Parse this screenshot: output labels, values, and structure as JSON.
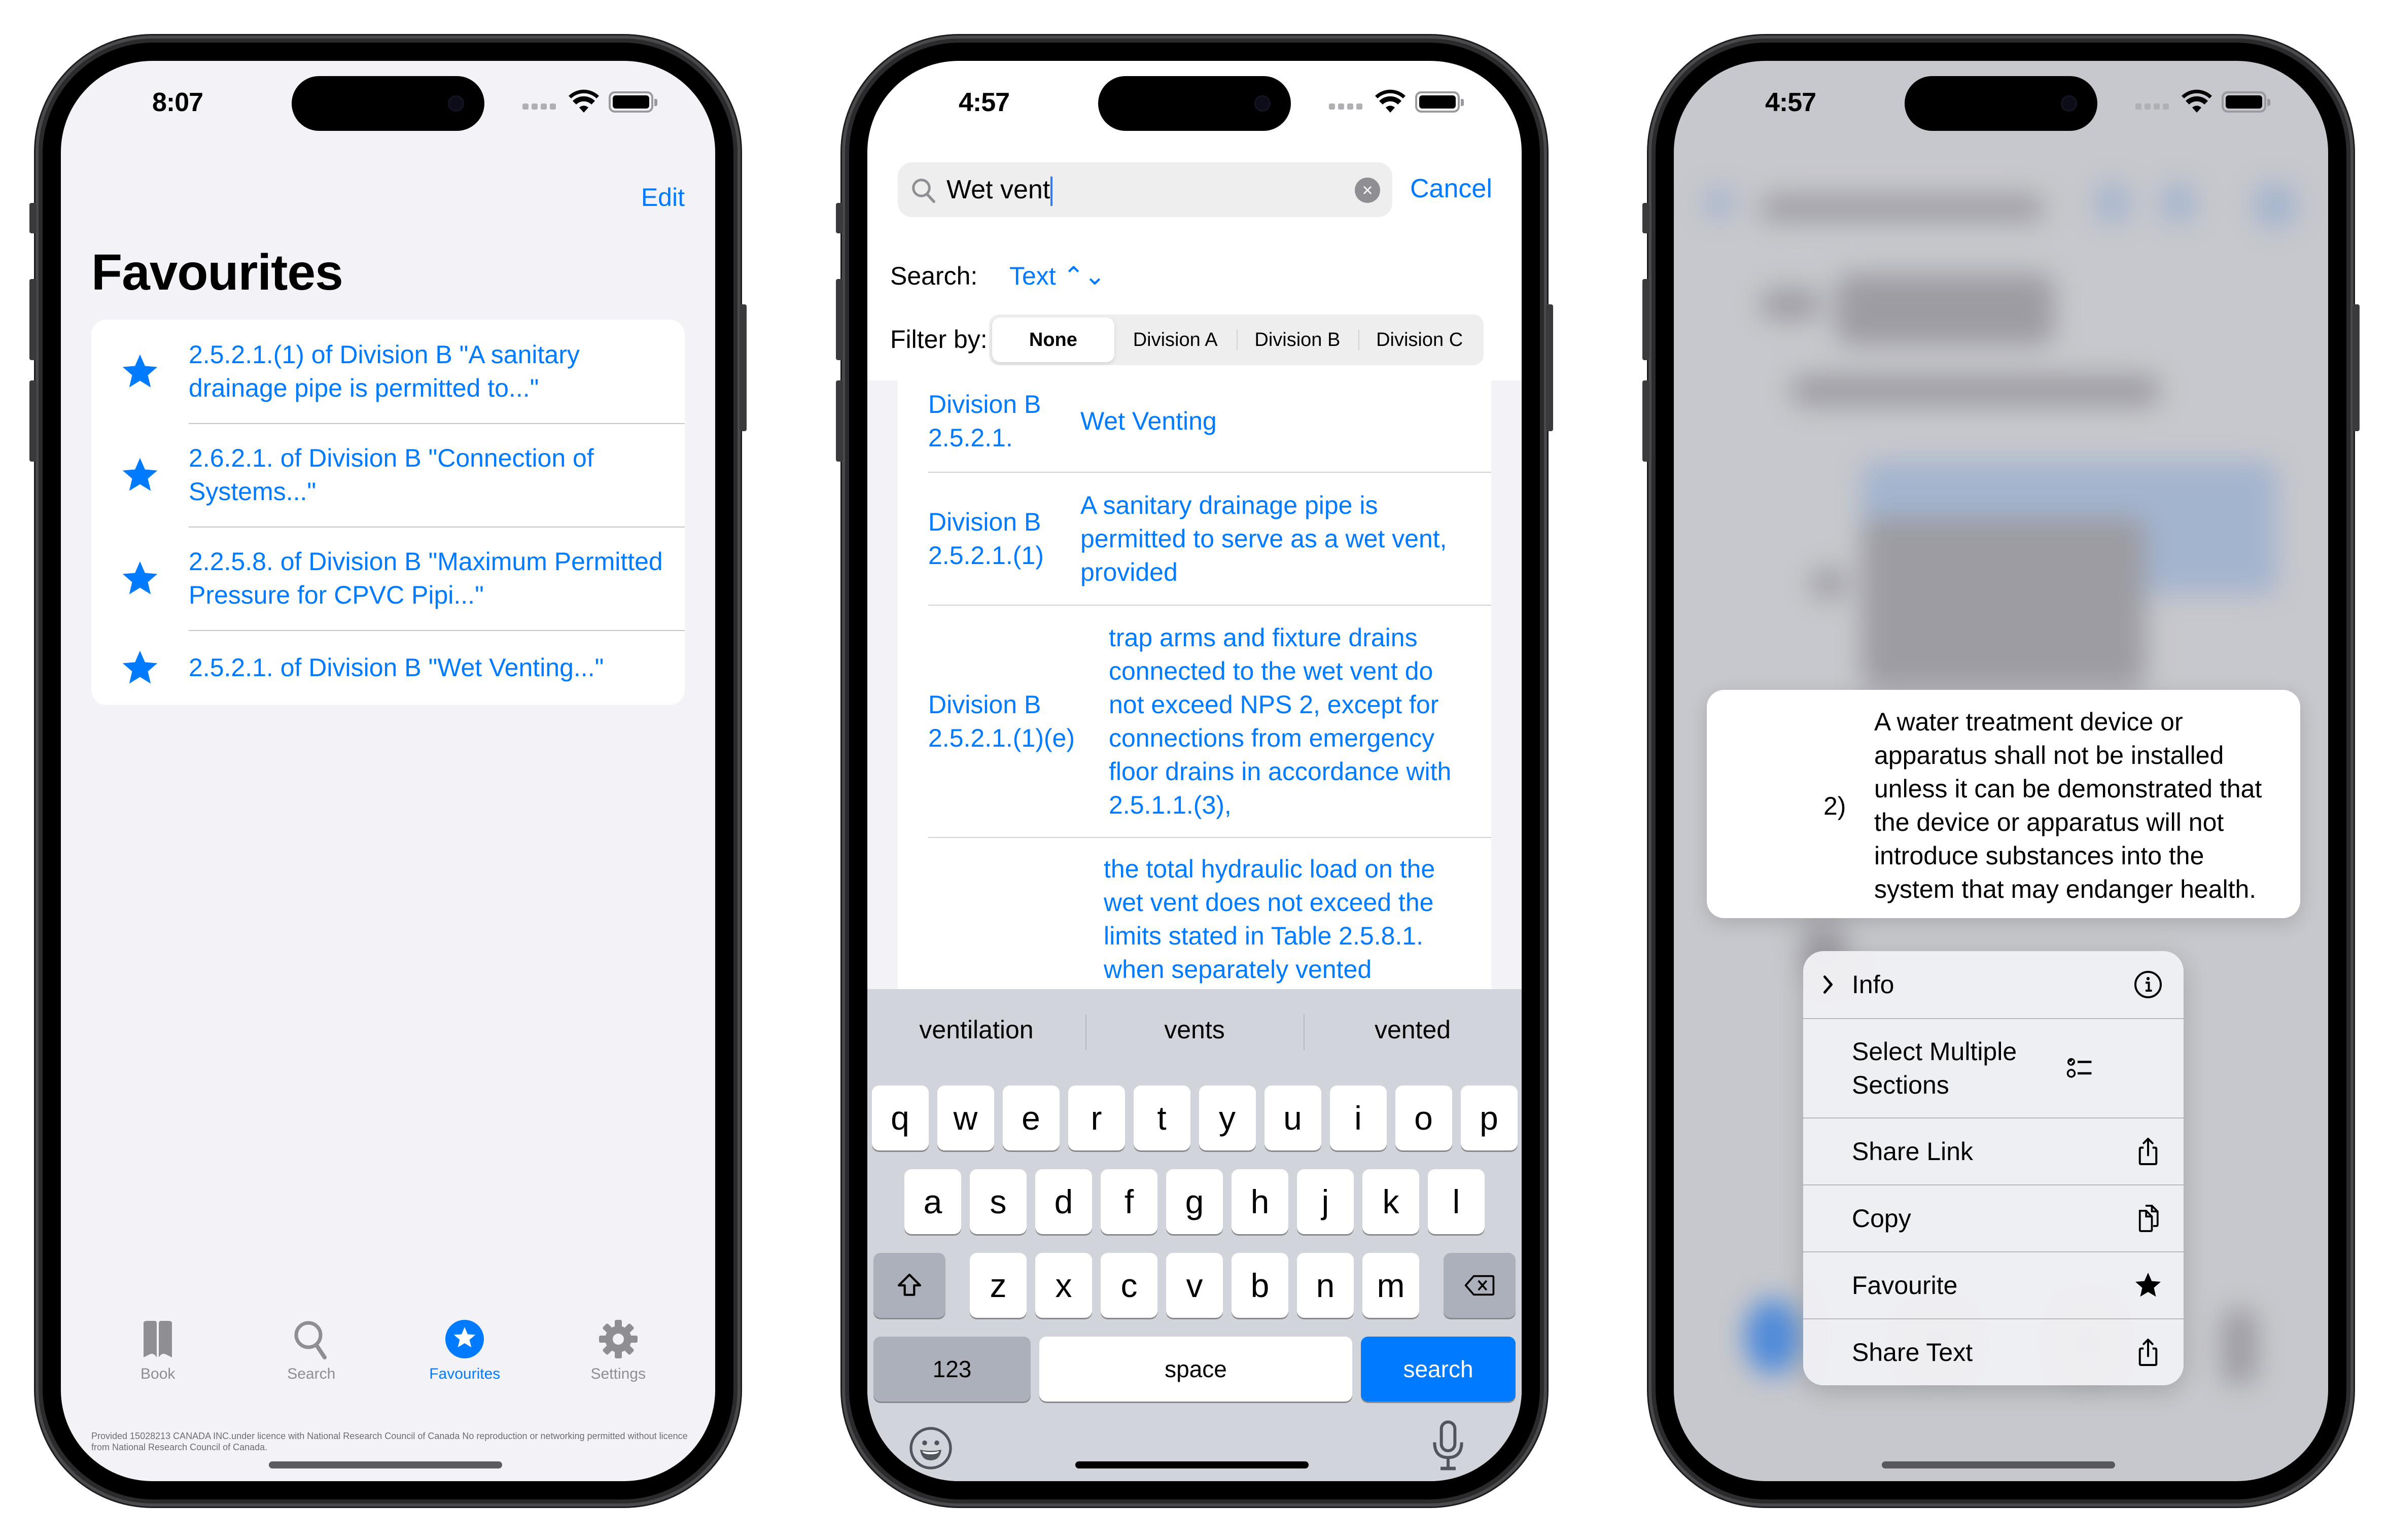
{
  "phones": [
    {
      "status": {
        "time": "8:07"
      },
      "nav": {
        "edit_label": "Edit",
        "title": "Favourites"
      },
      "favourites": [
        {
          "text": "2.5.2.1.(1) of Division B \"A sanitary drainage pipe is permitted to...\""
        },
        {
          "text": "2.6.2.1. of Division B \"Connection of Systems...\""
        },
        {
          "text": "2.2.5.8. of Division B \"Maximum Permitted Pressure for CPVC Pipi...\""
        },
        {
          "text": "2.5.2.1. of Division B \"Wet Venting...\""
        }
      ],
      "tabbar": {
        "tabs": [
          {
            "label": "Book",
            "icon": "book-icon",
            "active": false
          },
          {
            "label": "Search",
            "icon": "search-icon",
            "active": false
          },
          {
            "label": "Favourites",
            "icon": "star-circle-icon",
            "active": true
          },
          {
            "label": "Settings",
            "icon": "gear-icon",
            "active": false
          }
        ]
      },
      "licence": "Provided 15028213 CANADA INC.under licence with National Research Council of Canada No reproduction or networking permitted without licence from National Research Council of Canada."
    },
    {
      "status": {
        "time": "4:57"
      },
      "search": {
        "value": "Wet vent",
        "cancel_label": "Cancel",
        "search_label": "Search:",
        "search_type": "Text ⌃⌄",
        "filter_label": "Filter by:",
        "filters": [
          {
            "label": "None",
            "selected": true
          },
          {
            "label": "Division A",
            "selected": false
          },
          {
            "label": "Division B",
            "selected": false
          },
          {
            "label": "Division C",
            "selected": false
          }
        ]
      },
      "results": [
        {
          "ref": "Division B 2.5.2.1.",
          "text": "Wet Venting"
        },
        {
          "ref": "Division B 2.5.2.1.(1)",
          "text": "A sanitary drainage pipe is permitted to serve as a wet vent, provided"
        },
        {
          "ref": "Division B 2.5.2.1.(1)(e)",
          "text": "trap arms and fixture drains connected to the wet vent do not exceed NPS 2, except for connections from emergency floor drains in accordance with 2.5.1.1.(3),"
        },
        {
          "ref": "",
          "text": "the total hydraulic load on the wet vent does not exceed the limits stated in Table 2.5.8.1. when separately vented"
        }
      ],
      "keyboard": {
        "suggestions": [
          "ventilation",
          "vents",
          "vented"
        ],
        "row1": [
          "q",
          "w",
          "e",
          "r",
          "t",
          "y",
          "u",
          "i",
          "o",
          "p"
        ],
        "row2": [
          "a",
          "s",
          "d",
          "f",
          "g",
          "h",
          "j",
          "k",
          "l"
        ],
        "row3": [
          "z",
          "x",
          "c",
          "v",
          "b",
          "n",
          "m"
        ],
        "numbers_label": "123",
        "space_label": "space",
        "action_label": "search"
      }
    },
    {
      "status": {
        "time": "4:57"
      },
      "preview": {
        "number": "2)",
        "text": "A water treatment device or apparatus shall not be installed unless it can be demonstrated that the device or apparatus will not introduce substances into the system that may endanger health."
      },
      "menu": [
        {
          "label": "Info",
          "icon": "info-circle-icon",
          "has_chevron": true
        },
        {
          "label": "Select Multiple Sections",
          "icon": "checklist-icon",
          "has_chevron": false
        },
        {
          "label": "Share Link",
          "icon": "share-icon",
          "has_chevron": false
        },
        {
          "label": "Copy",
          "icon": "copy-icon",
          "has_chevron": false
        },
        {
          "label": "Favourite",
          "icon": "star-icon",
          "has_chevron": false
        },
        {
          "label": "Share Text",
          "icon": "share-icon",
          "has_chevron": false
        }
      ]
    }
  ],
  "colors": {
    "accent": "#007aff",
    "grouped_background": "#f2f2f7",
    "keyboard_background": "#d1d4db",
    "inactive_tab": "#8e8e93"
  }
}
